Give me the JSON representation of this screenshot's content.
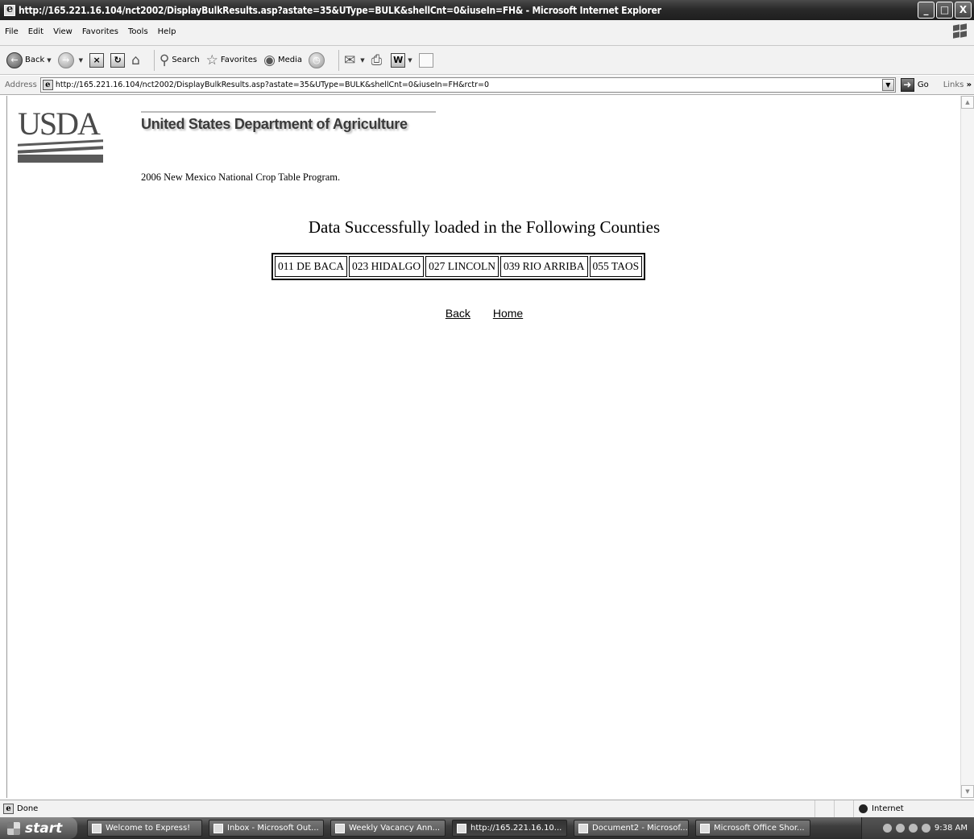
{
  "window": {
    "title": "http://165.221.16.104/nct2002/DisplayBulkResults.asp?astate=35&UType=BULK&shellCnt=0&iuseIn=FH& - Microsoft Internet Explorer",
    "buttons": [
      "_",
      "□",
      "X"
    ]
  },
  "menu": [
    "File",
    "Edit",
    "View",
    "Favorites",
    "Tools",
    "Help"
  ],
  "toolbar": {
    "back_label": "Back",
    "search_label": "Search",
    "favorites_label": "Favorites",
    "media_label": "Media"
  },
  "address": {
    "label": "Address",
    "url": "http://165.221.16.104/nct2002/DisplayBulkResults.asp?astate=35&UType=BULK&shellCnt=0&iuseIn=FH&rctr=0",
    "go_label": "Go",
    "links_label": "Links"
  },
  "page": {
    "logo_text": "USDA",
    "banner_title": "United States Department of Agriculture",
    "program": "2006 New Mexico National Crop Table Program.",
    "heading": "Data Successfully loaded in the Following Counties",
    "counties": [
      "011 DE BACA",
      "023 HIDALGO",
      "027 LINCOLN",
      "039 RIO ARRIBA",
      "055 TAOS"
    ],
    "links": {
      "back": "Back",
      "home": "Home"
    }
  },
  "status": {
    "text": "Done",
    "zone": "Internet"
  },
  "taskbar": {
    "start_label": "start",
    "tasks": [
      "Welcome to Express!",
      "Inbox - Microsoft Out...",
      "Weekly Vacancy Ann...",
      "http://165.221.16.10...",
      "Document2 - Microsof...",
      "Microsoft Office Shor..."
    ],
    "active_task_index": 3,
    "clock": "9:38 AM"
  }
}
